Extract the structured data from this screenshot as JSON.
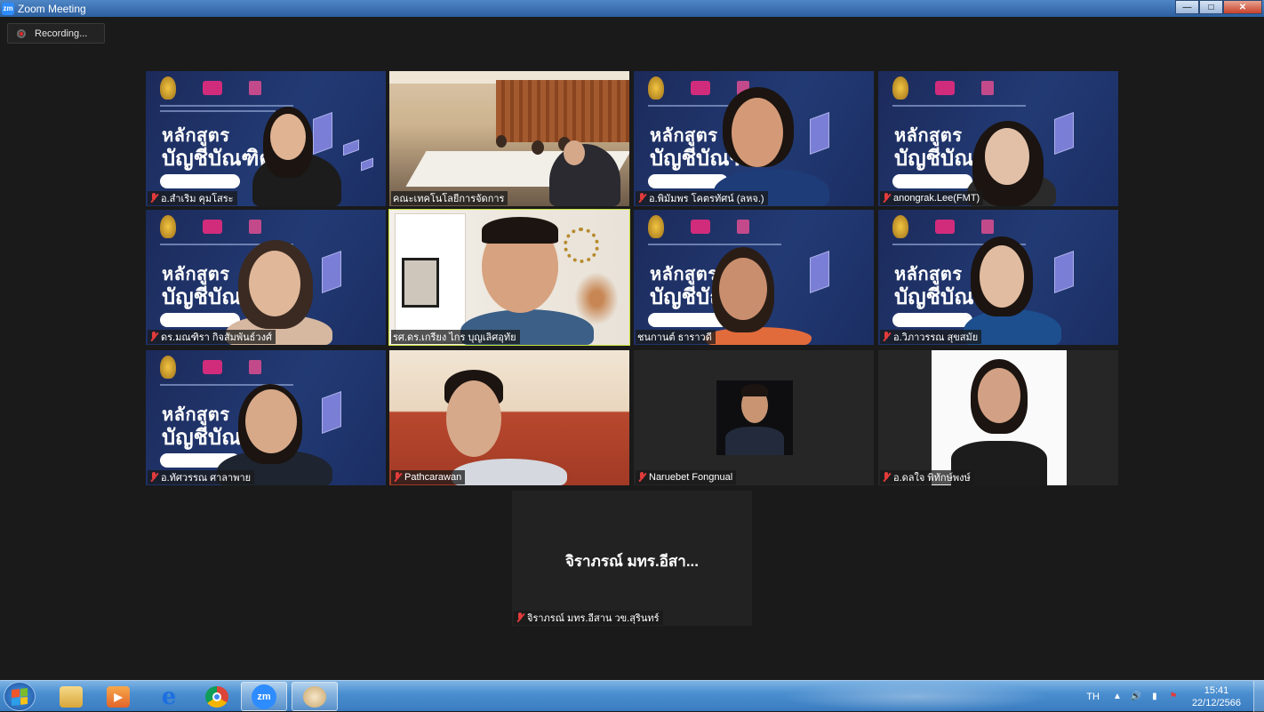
{
  "window": {
    "title": "Zoom Meeting",
    "app_icon": "zm"
  },
  "recording": {
    "label": "Recording..."
  },
  "participants": [
    {
      "name": "อ.สำเริม คุมโสระ"
    },
    {
      "name": "คณะเทคโนโลยีการจัดการ"
    },
    {
      "name": "อ.พิมัมพร โคตรทัศน์ (ลหจ.)"
    },
    {
      "name": "anongrak.Lee(FMT)"
    },
    {
      "name": "ดร.มณฑิรา กิจสัมพันธ์วงศ์"
    },
    {
      "name": "รศ.ดร.เกรียง ไกร บุญเลิศอุทัย",
      "active_speaker": true
    },
    {
      "name": "ชนกานต์ ธาราวดี"
    },
    {
      "name": "อ.วิภาวรรณ สุขสมัย"
    },
    {
      "name": "อ.ทัศวรรณ ศาลาพาย"
    },
    {
      "name": "Pathcarawan"
    },
    {
      "name": "Naruebet Fongnual"
    },
    {
      "name": "อ.ดลใจ พิทักษ์พงษ์"
    }
  ],
  "camera_off_participant": {
    "display_name": "จิราภรณ์ มทร.อีสา...",
    "name": "จิราภรณ์ มทร.อีสาน วข.สุรินทร์"
  },
  "slide": {
    "line1": "หลักสูตร",
    "line2": "บัญชีบัณฑิต"
  },
  "taskbar": {
    "apps": [
      "start-button",
      "file-explorer",
      "media-player",
      "internet-explorer",
      "chrome",
      "zoom",
      "paint"
    ],
    "zoom_label": "zm",
    "language": "TH",
    "time": "15:41",
    "date": "22/12/2566"
  },
  "colors": {
    "active_speaker_border": "#c9e53a",
    "muted_mic": "#e23b3b",
    "zoom_blue": "#2d8cff"
  }
}
